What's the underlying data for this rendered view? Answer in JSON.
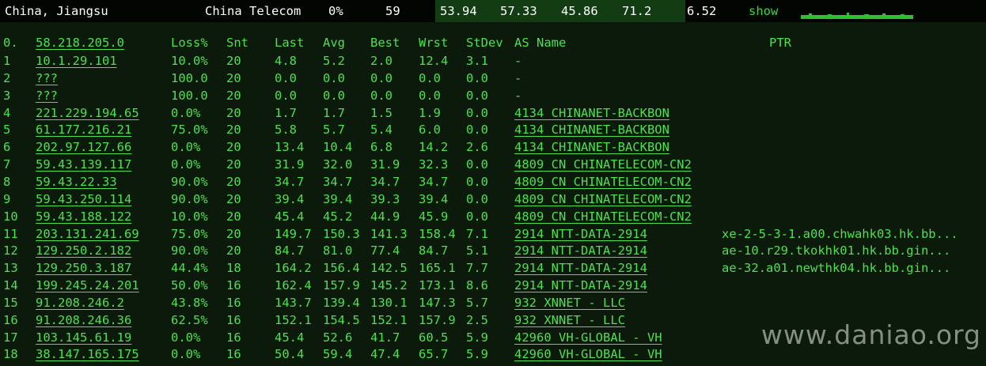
{
  "summary": {
    "location": "China, Jiangsu",
    "isp": "China Telecom",
    "loss": "0%",
    "sent": "59",
    "last": "53.94",
    "avg": "57.33",
    "best": "45.86",
    "worst": "71.2",
    "stdev": "6.52",
    "show_label": "show"
  },
  "headers": {
    "hop": "0.",
    "host": "58.218.205.0",
    "loss": "Loss%",
    "snt": "Snt",
    "last": "Last",
    "avg": "Avg",
    "best": "Best",
    "wrst": "Wrst",
    "stdev": "StDev",
    "as": "AS Name",
    "ptr": "PTR"
  },
  "hops": [
    {
      "hop": "1",
      "host": "10.1.29.101",
      "loss": "10.0%",
      "snt": "20",
      "last": "4.8",
      "avg": "5.2",
      "best": "2.0",
      "wrst": "12.4",
      "stdev": "3.1",
      "as": "-",
      "ptr": ""
    },
    {
      "hop": "2",
      "host": "???",
      "loss": "100.0",
      "snt": "20",
      "last": "0.0",
      "avg": "0.0",
      "best": "0.0",
      "wrst": "0.0",
      "stdev": "0.0",
      "as": "-",
      "ptr": ""
    },
    {
      "hop": "3",
      "host": "???",
      "loss": "100.0",
      "snt": "20",
      "last": "0.0",
      "avg": "0.0",
      "best": "0.0",
      "wrst": "0.0",
      "stdev": "0.0",
      "as": "-",
      "ptr": ""
    },
    {
      "hop": "4",
      "host": "221.229.194.65",
      "loss": "0.0%",
      "snt": "20",
      "last": "1.7",
      "avg": "1.7",
      "best": "1.5",
      "wrst": "1.9",
      "stdev": "0.0",
      "as": "4134  CHINANET-BACKBON",
      "ptr": ""
    },
    {
      "hop": "5",
      "host": "61.177.216.21",
      "loss": "75.0%",
      "snt": "20",
      "last": "5.8",
      "avg": "5.7",
      "best": "5.4",
      "wrst": "6.0",
      "stdev": "0.0",
      "as": "4134  CHINANET-BACKBON",
      "ptr": ""
    },
    {
      "hop": "6",
      "host": "202.97.127.66",
      "loss": "0.0%",
      "snt": "20",
      "last": "13.4",
      "avg": "10.4",
      "best": "6.8",
      "wrst": "14.2",
      "stdev": "2.6",
      "as": "4134  CHINANET-BACKBON",
      "ptr": ""
    },
    {
      "hop": "7",
      "host": "59.43.139.117",
      "loss": "0.0%",
      "snt": "20",
      "last": "31.9",
      "avg": "32.0",
      "best": "31.9",
      "wrst": "32.3",
      "stdev": "0.0",
      "as": "4809  CN CHINATELECOM-CN2",
      "ptr": ""
    },
    {
      "hop": "8",
      "host": "59.43.22.33",
      "loss": "90.0%",
      "snt": "20",
      "last": "34.7",
      "avg": "34.7",
      "best": "34.7",
      "wrst": "34.7",
      "stdev": "0.0",
      "as": "4809  CN CHINATELECOM-CN2",
      "ptr": ""
    },
    {
      "hop": "9",
      "host": "59.43.250.114",
      "loss": "90.0%",
      "snt": "20",
      "last": "39.4",
      "avg": "39.4",
      "best": "39.3",
      "wrst": "39.4",
      "stdev": "0.0",
      "as": "4809  CN CHINATELECOM-CN2",
      "ptr": ""
    },
    {
      "hop": "10",
      "host": "59.43.188.122",
      "loss": "10.0%",
      "snt": "20",
      "last": "45.4",
      "avg": "45.2",
      "best": "44.9",
      "wrst": "45.9",
      "stdev": "0.0",
      "as": "4809  CN CHINATELECOM-CN2",
      "ptr": ""
    },
    {
      "hop": "11",
      "host": "203.131.241.69",
      "loss": "75.0%",
      "snt": "20",
      "last": "149.7",
      "avg": "150.3",
      "best": "141.3",
      "wrst": "158.4",
      "stdev": "7.1",
      "as": "2914  NTT-DATA-2914",
      "ptr": "xe-2-5-3-1.a00.chwahk03.hk.bb..."
    },
    {
      "hop": "12",
      "host": "129.250.2.182",
      "loss": "90.0%",
      "snt": "20",
      "last": "84.7",
      "avg": "81.0",
      "best": "77.4",
      "wrst": "84.7",
      "stdev": "5.1",
      "as": "2914  NTT-DATA-2914",
      "ptr": "ae-10.r29.tkokhk01.hk.bb.gin..."
    },
    {
      "hop": "13",
      "host": "129.250.3.187",
      "loss": "44.4%",
      "snt": "18",
      "last": "164.2",
      "avg": "156.4",
      "best": "142.5",
      "wrst": "165.1",
      "stdev": "7.7",
      "as": "2914  NTT-DATA-2914",
      "ptr": "ae-32.a01.newthk04.hk.bb.gin..."
    },
    {
      "hop": "14",
      "host": "199.245.24.201",
      "loss": "50.0%",
      "snt": "16",
      "last": "162.4",
      "avg": "157.9",
      "best": "145.2",
      "wrst": "173.1",
      "stdev": "8.6",
      "as": "2914  NTT-DATA-2914",
      "ptr": ""
    },
    {
      "hop": "15",
      "host": "91.208.246.2",
      "loss": "43.8%",
      "snt": "16",
      "last": "143.7",
      "avg": "139.4",
      "best": "130.1",
      "wrst": "147.3",
      "stdev": "5.7",
      "as": "932   XNNET - LLC",
      "ptr": ""
    },
    {
      "hop": "16",
      "host": "91.208.246.36",
      "loss": "62.5%",
      "snt": "16",
      "last": "152.1",
      "avg": "154.5",
      "best": "152.1",
      "wrst": "157.9",
      "stdev": "2.5",
      "as": "932   XNNET - LLC",
      "ptr": ""
    },
    {
      "hop": "17",
      "host": "103.145.61.19",
      "loss": "0.0%",
      "snt": "16",
      "last": "45.4",
      "avg": "52.6",
      "best": "41.7",
      "wrst": "60.5",
      "stdev": "5.9",
      "as": "42960 VH-GLOBAL - VH",
      "ptr": ""
    },
    {
      "hop": "18",
      "host": "38.147.165.175",
      "loss": "0.0%",
      "snt": "16",
      "last": "50.4",
      "avg": "59.4",
      "best": "47.4",
      "wrst": "65.7",
      "stdev": "5.9",
      "as": "42960 VH-GLOBAL - VH",
      "ptr": ""
    }
  ],
  "watermark": "www.daniao.org",
  "colors": {
    "background": "#0b1a0b",
    "text": "#4fe04f",
    "topbar_bg": "#020502",
    "topbar_highlight": "#123d12"
  }
}
